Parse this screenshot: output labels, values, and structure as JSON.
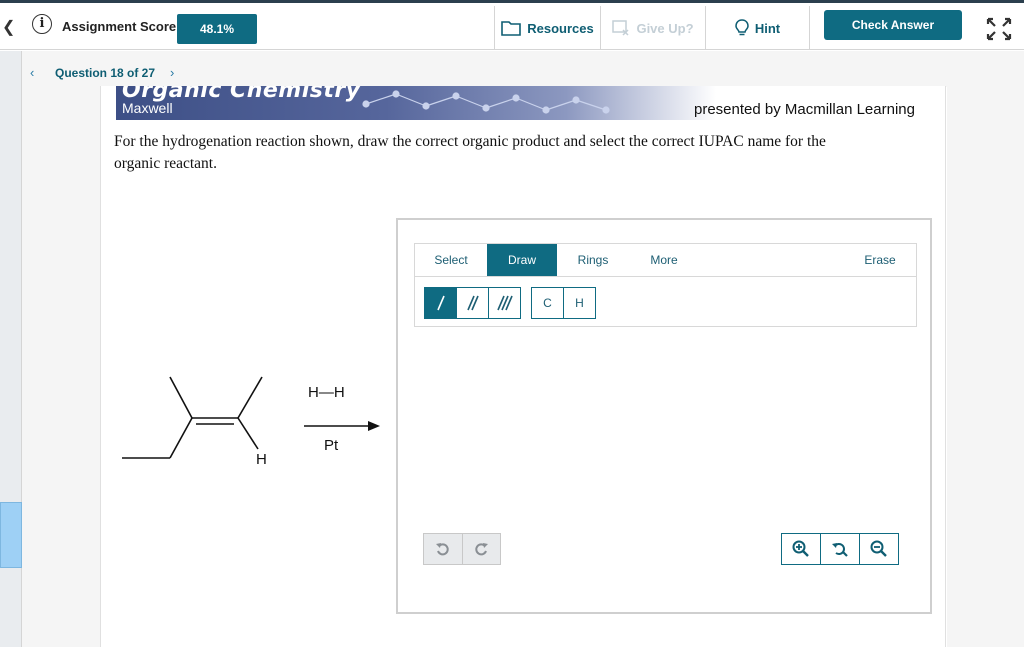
{
  "header": {
    "back_icon": "chevron-left-icon",
    "info_icon": "info-icon",
    "info_glyph": "i",
    "score_label": "Assignment Score:",
    "score_value": "48.1%",
    "resources_label": "Resources",
    "giveup_label": "Give Up?",
    "hint_label": "Hint",
    "check_answer_label": "Check Answer",
    "fullscreen_icon": "fullscreen-icon"
  },
  "question_nav": {
    "label": "Question 18 of 27"
  },
  "banner": {
    "book_title": "Organic Chemistry",
    "author": "Maxwell",
    "publisher": "presented by Macmillan Learning"
  },
  "question": {
    "text": "For the hydrogenation reaction shown, draw the correct organic product and select the correct IUPAC name for the organic reactant."
  },
  "reaction": {
    "hydrogen_atom_label": "H",
    "reagent_label": "H—H",
    "catalyst_label": "Pt"
  },
  "editor": {
    "tabs": [
      "Select",
      "Draw",
      "Rings",
      "More",
      "Erase"
    ],
    "active_tab": "Draw",
    "atom_tools": [
      "C",
      "H"
    ]
  },
  "colors": {
    "accent": "#0f6b82",
    "link": "#0f5e73",
    "banner": "#3d4f86"
  }
}
